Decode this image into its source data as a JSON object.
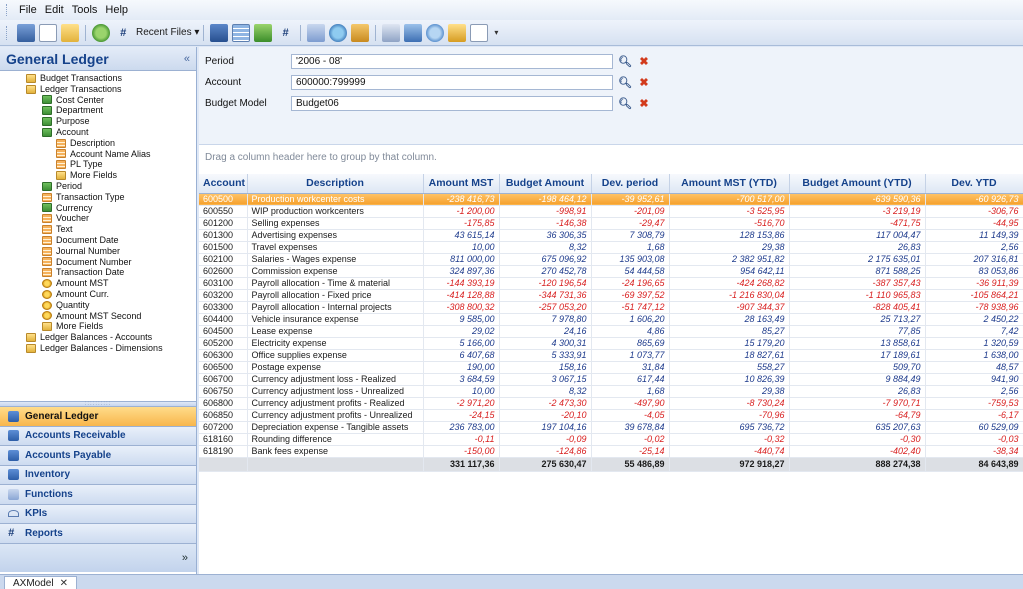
{
  "menu": [
    "File",
    "Edit",
    "Tools",
    "Help"
  ],
  "toolbar": {
    "recent_files_label": "Recent Files ▾"
  },
  "left_panel": {
    "title": "General Ledger",
    "collapse_glyph": "«",
    "tree": [
      {
        "label": "Budget Transactions",
        "icon": "folder-icon",
        "level": 1
      },
      {
        "label": "Ledger Transactions",
        "icon": "folder-icon",
        "level": 1
      },
      {
        "label": "Cost Center",
        "icon": "dimension-icon",
        "level": 2
      },
      {
        "label": "Department",
        "icon": "dimension-icon",
        "level": 2
      },
      {
        "label": "Purpose",
        "icon": "dimension-icon",
        "level": 2
      },
      {
        "label": "Account",
        "icon": "dimension-icon",
        "level": 2
      },
      {
        "label": "Description",
        "icon": "table-icon",
        "level": 3
      },
      {
        "label": "Account Name Alias",
        "icon": "table-icon",
        "level": 3
      },
      {
        "label": "PL Type",
        "icon": "table-icon",
        "level": 3
      },
      {
        "label": "More Fields",
        "icon": "folder-icon",
        "level": 3
      },
      {
        "label": "Period",
        "icon": "dimension-icon",
        "level": 2
      },
      {
        "label": "Transaction Type",
        "icon": "table-icon",
        "level": 2
      },
      {
        "label": "Currency",
        "icon": "dimension-icon",
        "level": 2
      },
      {
        "label": "Voucher",
        "icon": "table-icon",
        "level": 2
      },
      {
        "label": "Text",
        "icon": "table-icon",
        "level": 2
      },
      {
        "label": "Document Date",
        "icon": "table-icon",
        "level": 2
      },
      {
        "label": "Journal Number",
        "icon": "table-icon",
        "level": 2
      },
      {
        "label": "Document Number",
        "icon": "table-icon",
        "level": 2
      },
      {
        "label": "Transaction Date",
        "icon": "table-icon",
        "level": 2
      },
      {
        "label": "Amount MST",
        "icon": "measure-icon",
        "level": 2
      },
      {
        "label": "Amount Curr.",
        "icon": "measure-icon",
        "level": 2
      },
      {
        "label": "Quantity",
        "icon": "measure-icon",
        "level": 2
      },
      {
        "label": "Amount MST Second",
        "icon": "measure-icon",
        "level": 2
      },
      {
        "label": "More Fields",
        "icon": "folder-icon",
        "level": 2
      },
      {
        "label": "Ledger Balances - Accounts",
        "icon": "folder-icon",
        "level": 1
      },
      {
        "label": "Ledger Balances - Dimensions",
        "icon": "folder-icon",
        "level": 1
      }
    ],
    "nav": [
      {
        "label": "General Ledger",
        "icon": "ledger-icon",
        "active": true
      },
      {
        "label": "Accounts Receivable",
        "icon": "ledger-icon",
        "active": false
      },
      {
        "label": "Accounts Payable",
        "icon": "ledger-icon",
        "active": false
      },
      {
        "label": "Inventory",
        "icon": "ledger-icon",
        "active": false
      },
      {
        "label": "Functions",
        "icon": "functions-icon",
        "active": false
      },
      {
        "label": "KPIs",
        "icon": "kpi-icon",
        "active": false
      },
      {
        "label": "Reports",
        "icon": "reports-icon",
        "active": false
      }
    ],
    "footer_glyph": "»"
  },
  "filters": [
    {
      "label": "Period",
      "value": "'2006 - 08'"
    },
    {
      "label": "Account",
      "value": "600000:799999"
    },
    {
      "label": "Budget Model",
      "value": "Budget06"
    }
  ],
  "group_hint": "Drag a column header here to group by that column.",
  "grid": {
    "columns": [
      "Account",
      "Description",
      "Amount MST",
      "Budget Amount",
      "Dev. period",
      "Amount MST (YTD)",
      "Budget Amount (YTD)",
      "Dev. YTD"
    ],
    "rows": [
      [
        "600500",
        "Production workcenter costs",
        "-238 416,73",
        "-198 464,12",
        "-39 952,61",
        "-700 517,00",
        "-639 590,36",
        "-60 926,73"
      ],
      [
        "600550",
        "WIP production workcenters",
        "-1 200,00",
        "-998,91",
        "-201,09",
        "-3 525,95",
        "-3 219,19",
        "-306,76"
      ],
      [
        "601200",
        "Selling expenses",
        "-175,85",
        "-146,38",
        "-29,47",
        "-516,70",
        "-471,75",
        "-44,95"
      ],
      [
        "601300",
        "Advertising expenses",
        "43 615,14",
        "36 306,35",
        "7 308,79",
        "128 153,86",
        "117 004,47",
        "11 149,39"
      ],
      [
        "601500",
        "Travel expenses",
        "10,00",
        "8,32",
        "1,68",
        "29,38",
        "26,83",
        "2,56"
      ],
      [
        "602100",
        "Salaries - Wages expense",
        "811 000,00",
        "675 096,92",
        "135 903,08",
        "2 382 951,82",
        "2 175 635,01",
        "207 316,81"
      ],
      [
        "602600",
        "Commission expense",
        "324 897,36",
        "270 452,78",
        "54 444,58",
        "954 642,11",
        "871 588,25",
        "83 053,86"
      ],
      [
        "603100",
        "Payroll allocation - Time & material",
        "-144 393,19",
        "-120 196,54",
        "-24 196,65",
        "-424 268,82",
        "-387 357,43",
        "-36 911,39"
      ],
      [
        "603200",
        "Payroll allocation - Fixed price",
        "-414 128,88",
        "-344 731,36",
        "-69 397,52",
        "-1 216 830,04",
        "-1 110 965,83",
        "-105 864,21"
      ],
      [
        "603300",
        "Payroll allocation - Internal projects",
        "-308 800,32",
        "-257 053,20",
        "-51 747,12",
        "-907 344,37",
        "-828 405,41",
        "-78 938,96"
      ],
      [
        "604400",
        "Vehicle insurance expense",
        "9 585,00",
        "7 978,80",
        "1 606,20",
        "28 163,49",
        "25 713,27",
        "2 450,22"
      ],
      [
        "604500",
        "Lease expense",
        "29,02",
        "24,16",
        "4,86",
        "85,27",
        "77,85",
        "7,42"
      ],
      [
        "605200",
        "Electricity expense",
        "5 166,00",
        "4 300,31",
        "865,69",
        "15 179,20",
        "13 858,61",
        "1 320,59"
      ],
      [
        "606300",
        "Office supplies expense",
        "6 407,68",
        "5 333,91",
        "1 073,77",
        "18 827,61",
        "17 189,61",
        "1 638,00"
      ],
      [
        "606500",
        "Postage expense",
        "190,00",
        "158,16",
        "31,84",
        "558,27",
        "509,70",
        "48,57"
      ],
      [
        "606700",
        "Currency adjustment loss - Realized",
        "3 684,59",
        "3 067,15",
        "617,44",
        "10 826,39",
        "9 884,49",
        "941,90"
      ],
      [
        "606750",
        "Currency adjustment loss - Unrealized",
        "10,00",
        "8,32",
        "1,68",
        "29,38",
        "26,83",
        "2,56"
      ],
      [
        "606800",
        "Currency adjustment profits - Realized",
        "-2 971,20",
        "-2 473,30",
        "-497,90",
        "-8 730,24",
        "-7 970,71",
        "-759,53"
      ],
      [
        "606850",
        "Currency adjustment profits - Unrealized",
        "-24,15",
        "-20,10",
        "-4,05",
        "-70,96",
        "-64,79",
        "-6,17"
      ],
      [
        "607200",
        "Depreciation expense - Tangible assets",
        "236 783,00",
        "197 104,16",
        "39 678,84",
        "695 736,72",
        "635 207,63",
        "60 529,09"
      ],
      [
        "618160",
        "Rounding difference",
        "-0,11",
        "-0,09",
        "-0,02",
        "-0,32",
        "-0,30",
        "-0,03"
      ],
      [
        "618190",
        "Bank fees expense",
        "-150,00",
        "-124,86",
        "-25,14",
        "-440,74",
        "-402,40",
        "-38,34"
      ]
    ],
    "totals": [
      "",
      "",
      "331 117,36",
      "275 630,47",
      "55 486,89",
      "972 918,27",
      "888 274,38",
      "84 643,89"
    ]
  },
  "document_tab": {
    "label": "AXModel",
    "close_glyph": "✕"
  },
  "colors": {
    "accent": "#15428b",
    "selected_row": "#f5a12d",
    "negative": "#d81f1f",
    "positive": "#1d3a8c"
  }
}
